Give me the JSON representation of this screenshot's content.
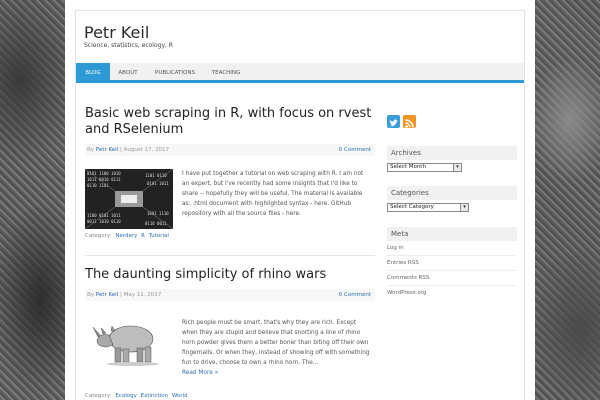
{
  "site": {
    "title": "Petr Keil",
    "description": "Science, statistics, ecology, R"
  },
  "nav": {
    "items": [
      {
        "label": "BLOG"
      },
      {
        "label": "ABOUT"
      },
      {
        "label": "PUBLICATIONS"
      },
      {
        "label": "TEACHING"
      }
    ]
  },
  "posts": [
    {
      "title": "Basic web scraping in R, with focus on rvest and RSelenium",
      "by": "By",
      "author": "Petr Keil",
      "date": "| August 17, 2017",
      "comments": "0 Comment",
      "excerpt": "I have put together a tutorial on web scraping with R. I am not an expert, but I've recently had some insights that I'd like to share -- hopefully they will be useful. The material is available as: .html document with highlighted syntax - here. GitHub repository with all the source files - here.",
      "category_label": "Category:",
      "categories": [
        "Nerdery",
        "R",
        "Tutorial"
      ],
      "thumbnail": "binary-data-image"
    },
    {
      "title": "The daunting simplicity of rhino wars",
      "by": "By",
      "author": "Petr Keil",
      "date": "| May 11, 2017",
      "comments": "0 Comment",
      "excerpt": "Rich people must be smart, that's why they are rich. Except when they are stupid and believe that snorting a line of rhino horn powder gives them a better boner than biting off their own fingernails. Or when they, instead of showing off with something fun to drive, choose to own a rhino horn. The…",
      "read_more": "Read More »",
      "category_label": "Category:",
      "categories": [
        "Ecology",
        "Extinction",
        "World"
      ],
      "thumbnail": "rhino-drawing"
    }
  ],
  "sidebar": {
    "social": [
      "twitter-icon",
      "rss-icon"
    ],
    "archives": {
      "heading": "Archives",
      "select": "Select Month"
    },
    "categories": {
      "heading": "Categories",
      "select": "Select Category"
    },
    "meta": {
      "heading": "Meta",
      "links": [
        "Log in",
        "Entries RSS",
        "Comments RSS",
        "WordPress.org"
      ]
    }
  },
  "colors": {
    "accent": "#2d9ad5",
    "link": "#2d6db5"
  }
}
